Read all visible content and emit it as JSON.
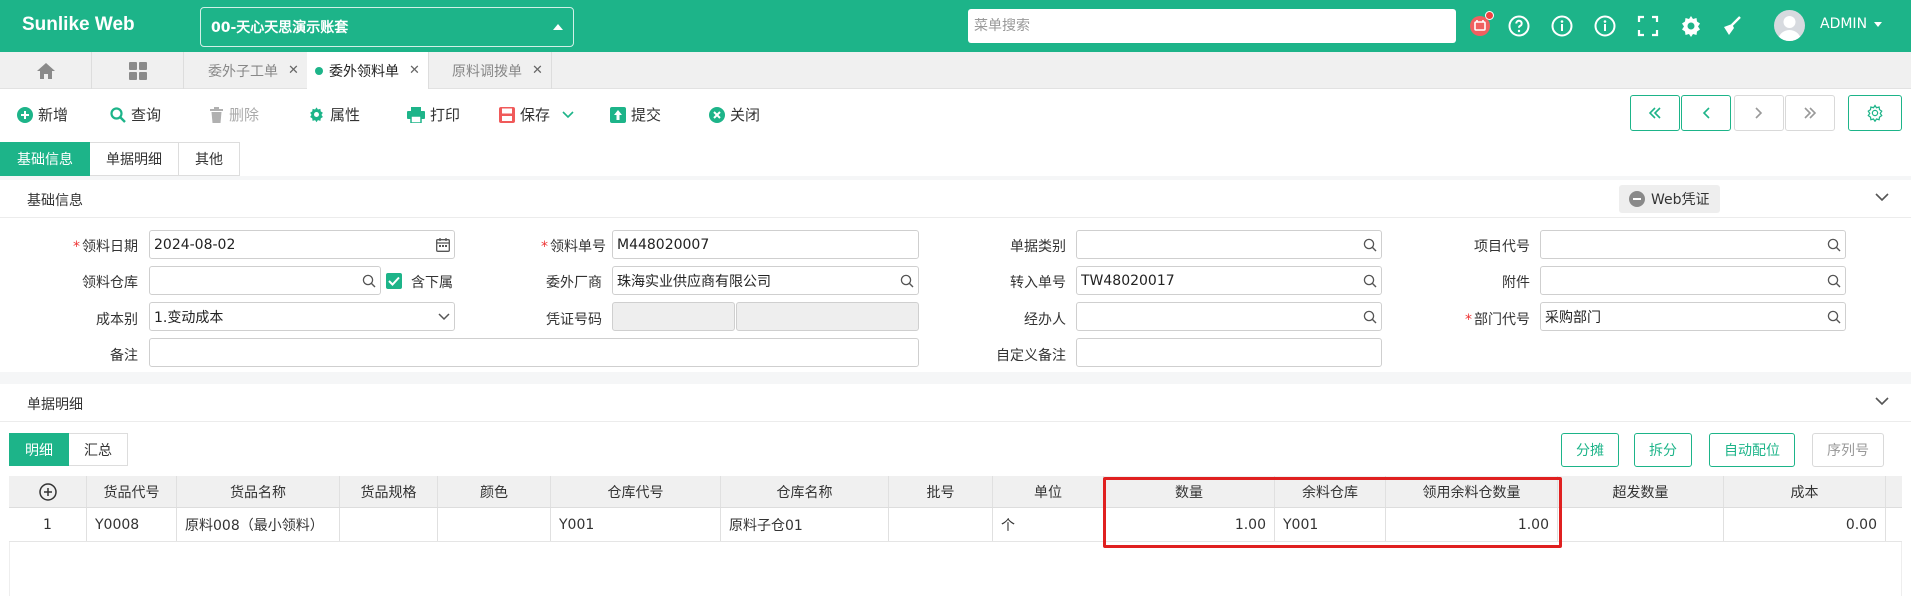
{
  "app": {
    "brand": "Sunlike Web",
    "account": "00-天心天思演示账套",
    "search_placeholder": "菜单搜索",
    "user": "ADMIN"
  },
  "colors": {
    "accent": "#1db489",
    "danger": "#e02020",
    "badge": "#f04040"
  },
  "tabs": [
    {
      "label": "委外子工单",
      "active": false
    },
    {
      "label": "委外领料单",
      "active": true
    },
    {
      "label": "原料调拨单",
      "active": false
    }
  ],
  "toolbar": {
    "add": "新增",
    "query": "查询",
    "delete": "删除",
    "props": "属性",
    "print": "打印",
    "save": "保存",
    "submit": "提交",
    "close": "关闭"
  },
  "subtabs": [
    "基础信息",
    "单据明细",
    "其他"
  ],
  "basic": {
    "title": "基础信息",
    "web_voucher": "Web凭证",
    "fields": {
      "date_label": "领料日期",
      "date_value": "2024-08-02",
      "doc_no_label": "领料单号",
      "doc_no_value": "M448020007",
      "doc_type_label": "单据类别",
      "doc_type_value": "",
      "project_label": "项目代号",
      "project_value": "",
      "wh_label": "领料仓库",
      "wh_value": "",
      "include_sub": "含下属",
      "vendor_label": "委外厂商",
      "vendor_value": "珠海实业供应商有限公司",
      "transfer_label": "转入单号",
      "transfer_value": "TW48020017",
      "attach_label": "附件",
      "attach_value": "",
      "cost_label": "成本别",
      "cost_value": "1.变动成本",
      "voucher_label": "凭证号码",
      "handler_label": "经办人",
      "handler_value": "",
      "dept_label": "部门代号",
      "dept_value": "采购部门",
      "remark_label": "备注",
      "remark_value": "",
      "custom_remark_label": "自定义备注",
      "custom_remark_value": ""
    }
  },
  "detail": {
    "title": "单据明细",
    "tabs": [
      "明细",
      "汇总"
    ],
    "actions": [
      "分摊",
      "拆分",
      "自动配位",
      "序列号"
    ],
    "columns": [
      "货品代号",
      "货品名称",
      "货品规格",
      "颜色",
      "仓库代号",
      "仓库名称",
      "批号",
      "单位",
      "数量",
      "余料仓库",
      "领用余料仓数量",
      "超发数量",
      "成本"
    ],
    "rows": [
      {
        "seq": "1",
        "code": "Y0008",
        "name": "原料008（最小领料）",
        "spec": "",
        "color": "",
        "wh_code": "Y001",
        "wh_name": "原料子仓01",
        "batch": "",
        "unit": "个",
        "qty": "1.00",
        "rem_wh": "Y001",
        "rem_qty": "1.00",
        "over_qty": "",
        "cost": "0.00"
      }
    ]
  }
}
